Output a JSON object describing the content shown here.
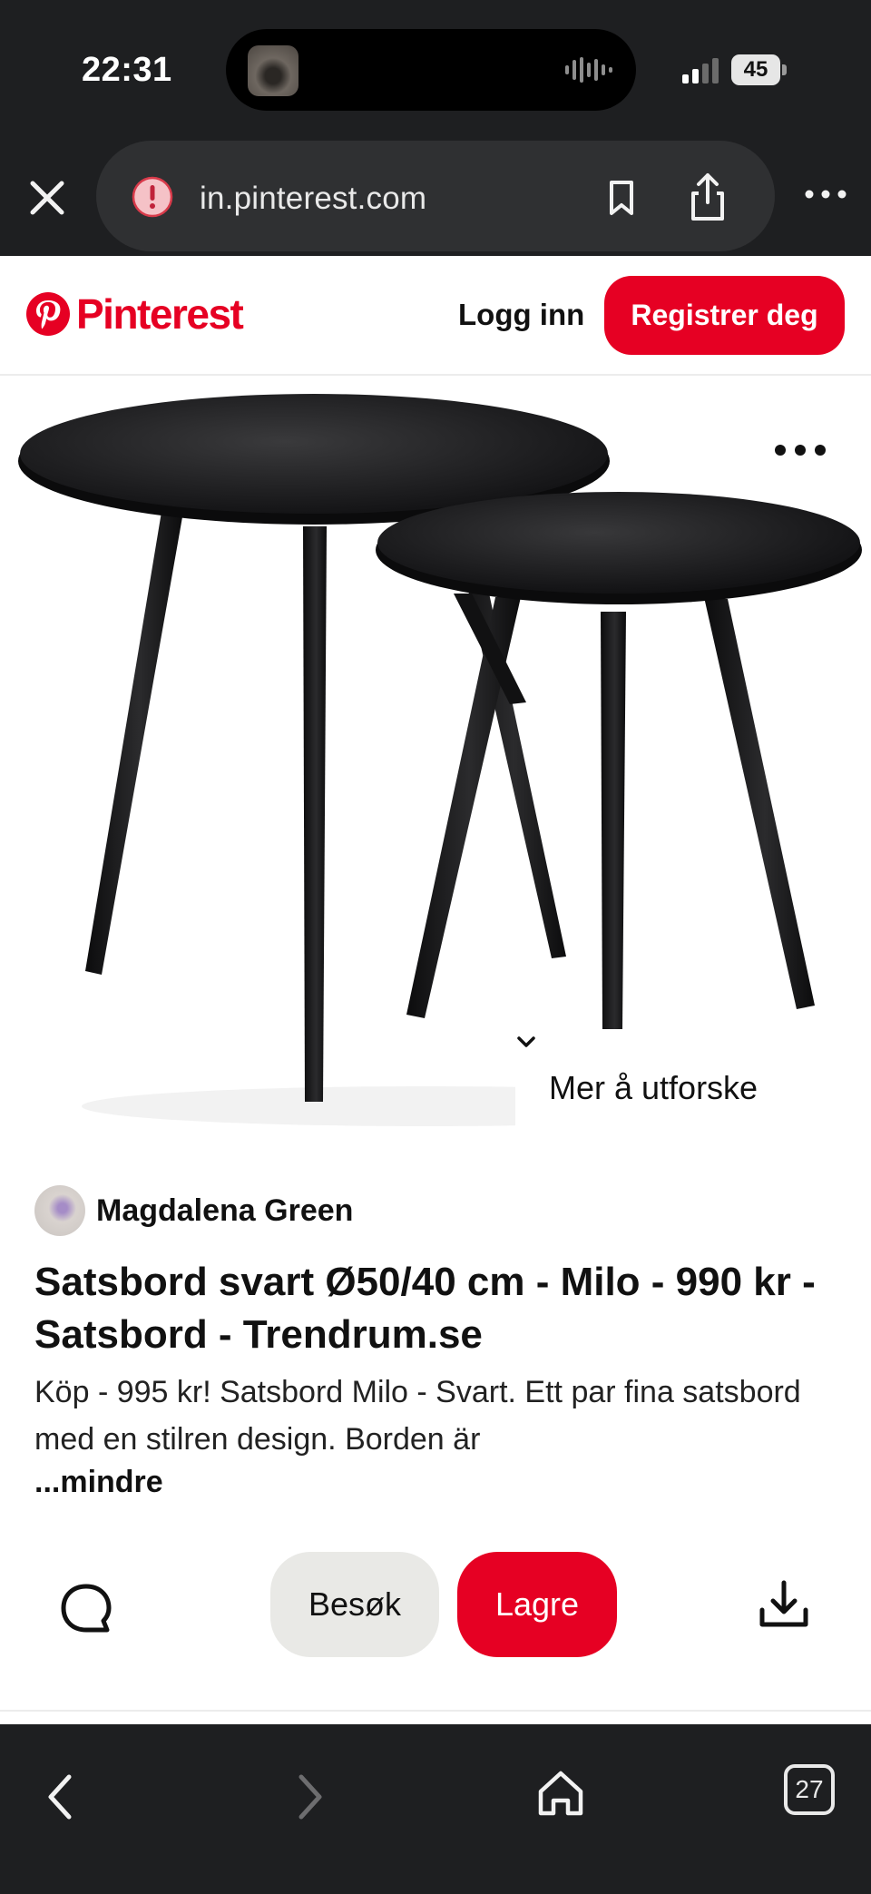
{
  "status_bar": {
    "time": "22:31",
    "battery": "45",
    "icons": [
      "signal-icon",
      "battery-icon",
      "audio-wave-icon"
    ]
  },
  "browser": {
    "url": "in.pinterest.com",
    "icons": [
      "close-icon",
      "site-warning-icon",
      "bookmark-icon",
      "share-icon",
      "more-icon"
    ]
  },
  "header": {
    "logo_text": "Pinterest",
    "login_label": "Logg inn",
    "register_label": "Registrer deg"
  },
  "pin": {
    "explore_label": "Mer å utforske",
    "creator_name": "Magdalena Green",
    "title": "Satsbord svart Ø50/40 cm - Milo - 990 kr - Satsbord - Trendrum.se",
    "description": "Köp - 995 kr! Satsbord Milo - Svart. Ett par fina satsbord med en stilren design. Borden är",
    "less_label": "...mindre"
  },
  "actions": {
    "visit_label": "Besøk",
    "save_label": "Lagre"
  },
  "bottom_bar": {
    "tabs_count": "27",
    "icons": [
      "back-icon",
      "forward-icon",
      "home-icon",
      "tabs-icon"
    ]
  },
  "colors": {
    "brand_red": "#e60023",
    "chrome_dark": "#1e1f21",
    "url_pill": "#2f3032",
    "visit_bg": "#e9e9e6"
  }
}
